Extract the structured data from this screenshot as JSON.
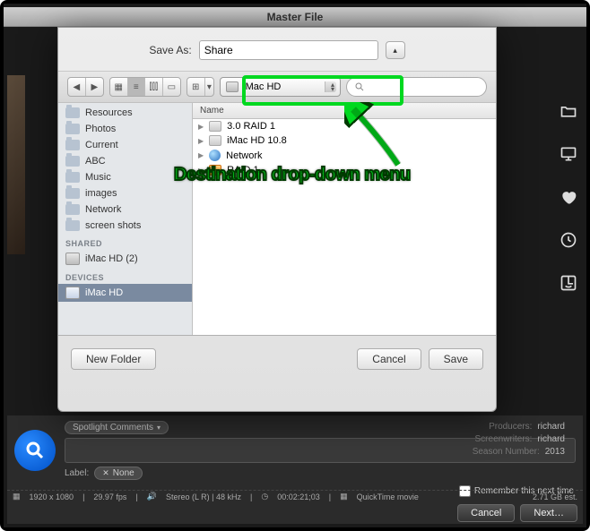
{
  "window": {
    "title": "Master File"
  },
  "save_as": {
    "label": "Save As:",
    "value": "Share"
  },
  "toolbar": {
    "destination": "iMac HD",
    "search_placeholder": ""
  },
  "sidebar": {
    "favorites": [
      "Resources",
      "Photos",
      "Current",
      "ABC",
      "Music",
      "images",
      "Network",
      "screen shots"
    ],
    "shared_hdr": "SHARED",
    "shared": [
      "iMac HD (2)"
    ],
    "devices_hdr": "DEVICES",
    "devices": [
      "iMac HD"
    ]
  },
  "filelist": {
    "header": "Name",
    "items": [
      "3.0 RAID 1",
      "iMac HD 10.8",
      "Network",
      "RAID 1"
    ]
  },
  "dialog_buttons": {
    "new_folder": "New Folder",
    "cancel": "Cancel",
    "save": "Save"
  },
  "annotation": {
    "text": "Destination drop-down menu"
  },
  "inspector": {
    "spotlight_label": "Spotlight Comments",
    "label_text": "Label:",
    "label_value": "None",
    "remember": "Remember this next time",
    "meta": {
      "producers_k": "Producers:",
      "producers_v": "richard",
      "screenwriters_k": "Screenwriters:",
      "screenwriters_v": "richard",
      "season_k": "Season Number:",
      "season_v": "2013"
    }
  },
  "status": {
    "res": "1920 x 1080",
    "fps": "29.97 fps",
    "audio": "Stereo (L R) | 48 kHz",
    "tc": "00:02:21;03",
    "container": "QuickTime movie",
    "size": "2.71 GB est."
  },
  "final_buttons": {
    "cancel": "Cancel",
    "next": "Next…"
  }
}
